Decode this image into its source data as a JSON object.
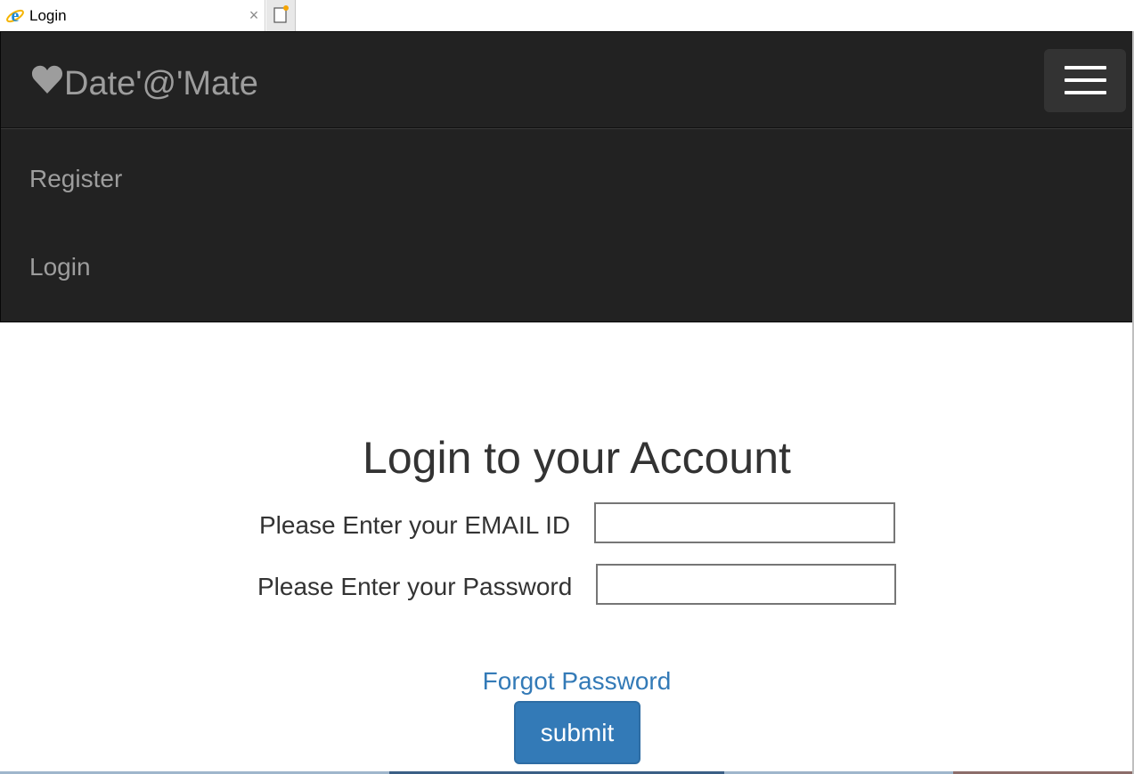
{
  "browser": {
    "tab_title": "Login",
    "tab_close": "×",
    "favicon_icon": "internet-explorer-icon",
    "newtab_icon": "new-tab-icon"
  },
  "navbar": {
    "brand": "Date'@'Mate",
    "brand_icon": "heart-icon",
    "toggle_icon": "hamburger-icon",
    "items": [
      {
        "label": "Register"
      },
      {
        "label": "Login"
      }
    ]
  },
  "login": {
    "title": "Login to your Account",
    "email_label": "Please Enter your EMAIL ID",
    "email_value": "",
    "password_label": "Please Enter your Password",
    "password_value": "",
    "forgot_label": "Forgot Password",
    "submit_label": "submit"
  },
  "colors": {
    "navbar_bg": "#222222",
    "nav_text": "#9d9d9d",
    "link": "#337ab7",
    "button_bg": "#337ab7",
    "text": "#333333"
  }
}
